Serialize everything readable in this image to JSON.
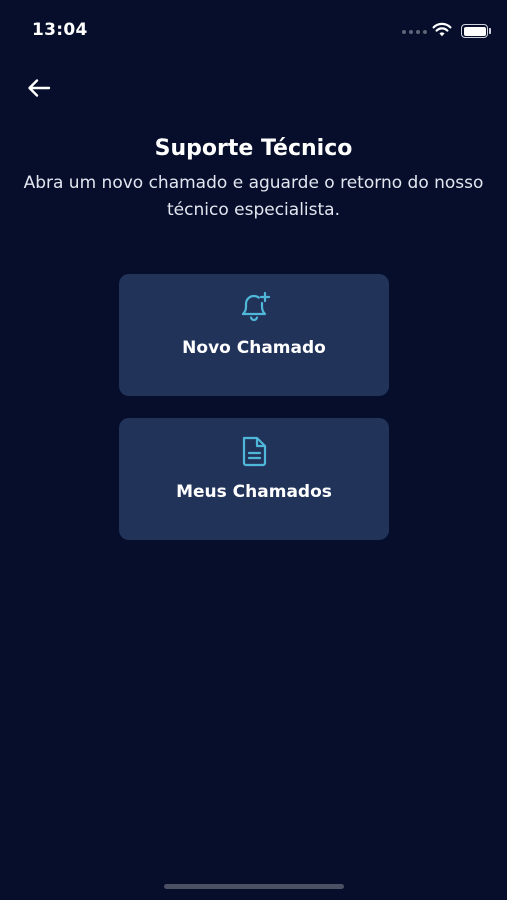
{
  "status_bar": {
    "time": "13:04"
  },
  "header": {
    "title": "Suporte Técnico",
    "subtitle": "Abra um novo chamado e aguarde o retorno do nosso técnico especialista."
  },
  "actions": [
    {
      "label": "Novo Chamado",
      "icon": "bell-plus-icon"
    },
    {
      "label": "Meus Chamados",
      "icon": "document-icon"
    }
  ],
  "colors": {
    "background": "#060e2c",
    "card": "#22335a",
    "icon_accent": "#4fb8d8",
    "text": "#ffffff"
  }
}
